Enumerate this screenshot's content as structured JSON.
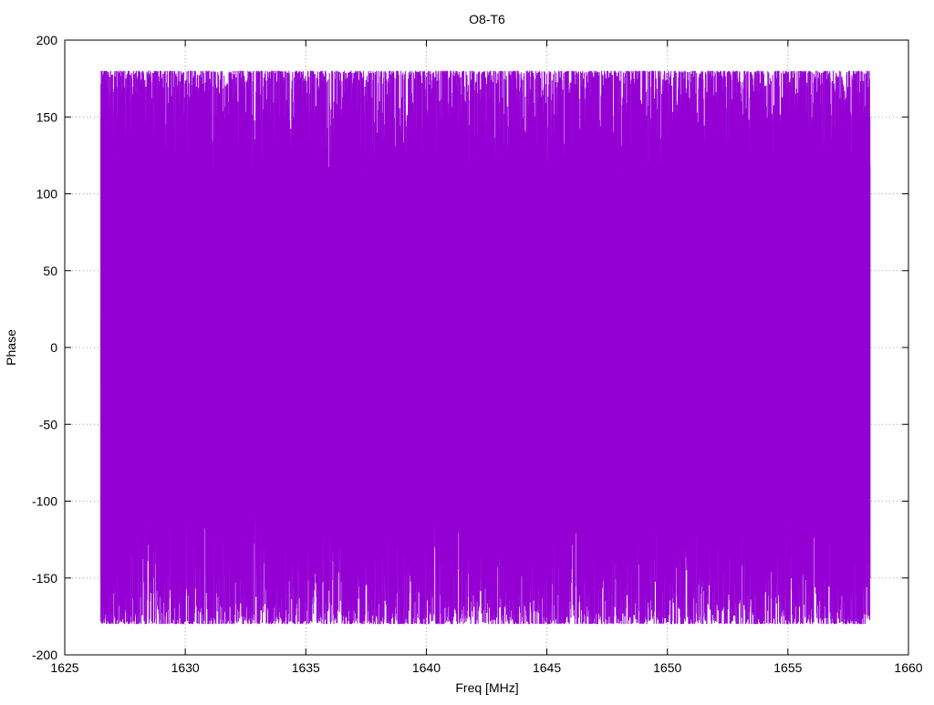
{
  "chart_data": {
    "type": "line",
    "title": "O8-T6",
    "xlabel": "Freq [MHz]",
    "ylabel": "Phase",
    "xlim": [
      1625,
      1660
    ],
    "ylim": [
      -200,
      200
    ],
    "x_ticks": [
      1625,
      1630,
      1635,
      1640,
      1645,
      1650,
      1655,
      1660
    ],
    "y_ticks": [
      -200,
      -150,
      -100,
      -50,
      0,
      50,
      100,
      150,
      200
    ],
    "grid": true,
    "legend": "none",
    "series": [
      {
        "color": "#9400d3",
        "x_range": [
          1626.5,
          1658.4
        ],
        "y_range": [
          -180,
          180
        ],
        "description_points": [
          {
            "x": 1626.5,
            "y": 22
          },
          {
            "x": 1626.5,
            "y": -178
          },
          {
            "x": 1626.6,
            "y": 178
          },
          {
            "x": 1627.0,
            "y": -170
          },
          {
            "x": 1627.6,
            "y": 175
          },
          {
            "x": 1628.1,
            "y": -62
          },
          {
            "x": 1628.1,
            "y": 75
          },
          {
            "x": 1628.3,
            "y": -178
          },
          {
            "x": 1629.0,
            "y": 176
          },
          {
            "x": 1629.9,
            "y": -75
          },
          {
            "x": 1630.1,
            "y": 76
          },
          {
            "x": 1631.0,
            "y": -178
          },
          {
            "x": 1632.0,
            "y": 178
          },
          {
            "x": 1633.0,
            "y": -176
          },
          {
            "x": 1634.0,
            "y": 177
          },
          {
            "x": 1635.0,
            "y": -178
          },
          {
            "x": 1636.0,
            "y": -75
          },
          {
            "x": 1637.0,
            "y": 178
          },
          {
            "x": 1638.0,
            "y": 69
          },
          {
            "x": 1639.0,
            "y": -178
          },
          {
            "x": 1640.0,
            "y": 176
          },
          {
            "x": 1641.0,
            "y": -176
          },
          {
            "x": 1642.2,
            "y": 24
          },
          {
            "x": 1643.0,
            "y": 178
          },
          {
            "x": 1644.0,
            "y": -178
          },
          {
            "x": 1645.0,
            "y": 178
          },
          {
            "x": 1646.0,
            "y": -176
          },
          {
            "x": 1647.0,
            "y": 176
          },
          {
            "x": 1648.0,
            "y": -178
          },
          {
            "x": 1648.4,
            "y": -75
          },
          {
            "x": 1649.0,
            "y": 177
          },
          {
            "x": 1650.0,
            "y": -176
          },
          {
            "x": 1651.0,
            "y": 178
          },
          {
            "x": 1652.0,
            "y": -178
          },
          {
            "x": 1652.8,
            "y": -82
          },
          {
            "x": 1653.0,
            "y": 176
          },
          {
            "x": 1654.0,
            "y": -178
          },
          {
            "x": 1654.5,
            "y": -79
          },
          {
            "x": 1655.0,
            "y": 178
          },
          {
            "x": 1656.0,
            "y": -178
          },
          {
            "x": 1657.0,
            "y": 178
          },
          {
            "x": 1658.0,
            "y": -178
          },
          {
            "x": 1658.4,
            "y": 118
          },
          {
            "x": 1658.4,
            "y": -150
          }
        ]
      }
    ]
  }
}
